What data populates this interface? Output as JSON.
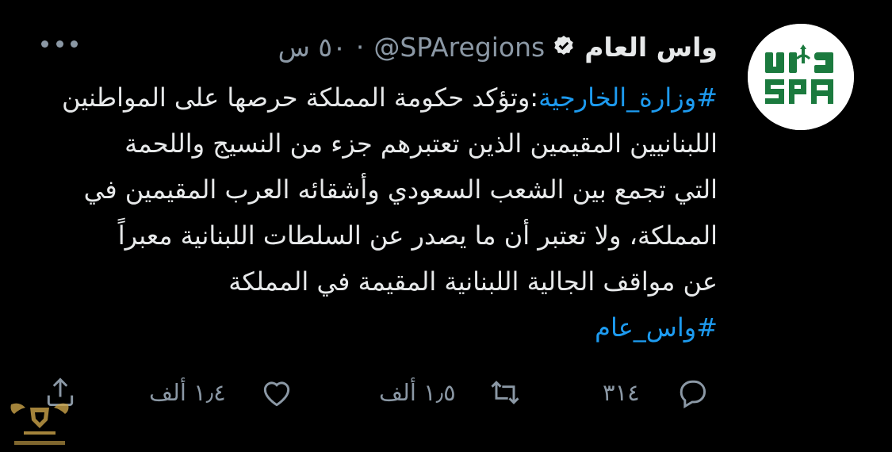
{
  "tweet": {
    "display_name": "واس العام",
    "handle": "@SPAregions",
    "separator": "·",
    "time": "٥٠ س",
    "body_lines": [
      {
        "hashtag": "#وزارة_الخارجية",
        "text": ":وتؤكد حكومة المملكة حرصها على المواطنين"
      },
      {
        "text": "اللبنانيين المقيمين الذين تعتبرهم جزء من النسيج واللحمة"
      },
      {
        "text": "التي تجمع بين الشعب السعودي وأشقائه العرب المقيمين في"
      },
      {
        "text": "المملكة، ولا تعتبر أن ما يصدر عن السلطات اللبنانية معبراً"
      },
      {
        "text": "عن مواقف الجالية اللبنانية المقيمة في المملكة"
      }
    ],
    "final_hashtag": "#واس_عام"
  },
  "avatar": {
    "logo_text_top": "واس",
    "logo_text_bottom": "SPA",
    "logo_color": "#1b7a3e"
  },
  "actions": {
    "reply_count": "٣١٤",
    "retweet_count": "١٫٥ ألف",
    "like_count": "١٫٤ ألف"
  },
  "icons": {
    "more": "more-horizontal-icon",
    "reply": "reply-icon",
    "retweet": "retweet-icon",
    "like": "heart-icon",
    "share": "share-icon",
    "verified": "verified-badge-icon"
  },
  "colors": {
    "background": "#000000",
    "text": "#e7e9ea",
    "muted": "#8b98a5",
    "link": "#1d9bf0"
  }
}
